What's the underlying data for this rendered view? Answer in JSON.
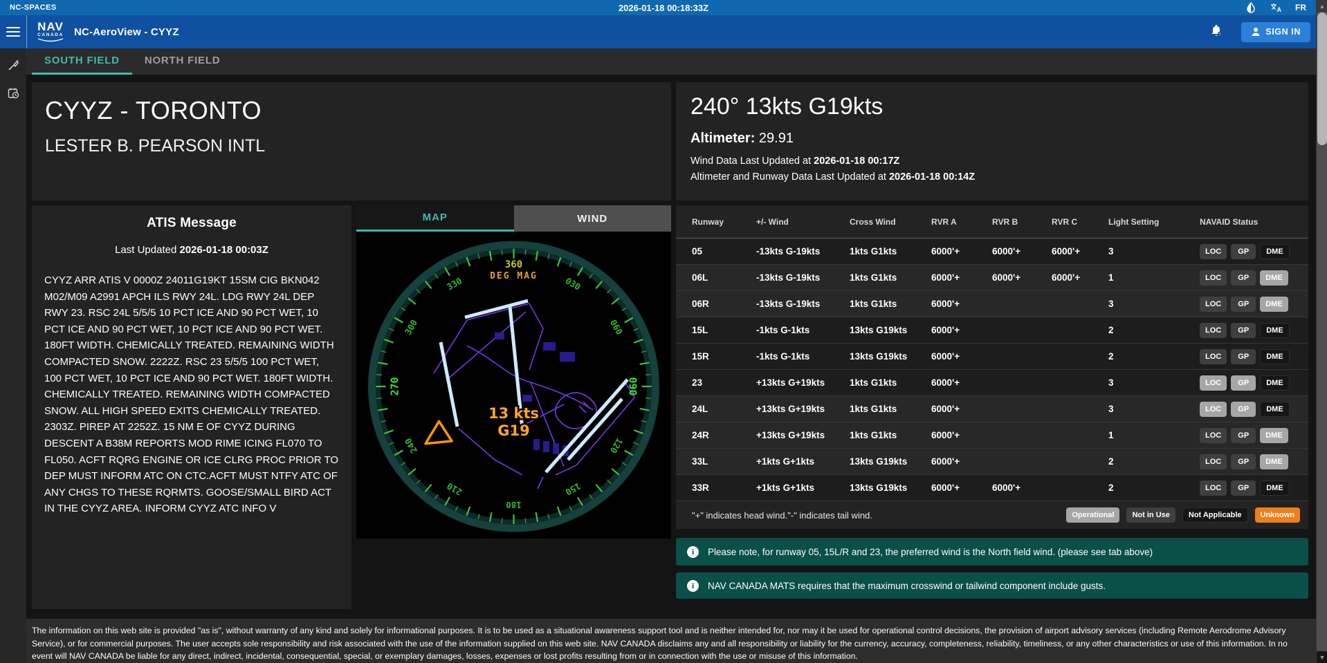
{
  "status_bar": {
    "brand": "NC-SPACES",
    "clock": "2026-01-18 00:18:33Z",
    "language": "FR"
  },
  "app_bar": {
    "logo_top": "NAV",
    "logo_bottom": "CANADA",
    "title": "NC-AeroView - CYYZ",
    "sign_in_label": "SIGN IN"
  },
  "field_tabs": {
    "south": "SOUTH FIELD",
    "north": "NORTH FIELD"
  },
  "airport_card": {
    "title": "CYYZ - TORONTO",
    "subtitle": "LESTER B. PEARSON INTL"
  },
  "wind_card": {
    "headline": "240° 13kts G19kts",
    "altimeter_label": "Altimeter:",
    "altimeter_value": "29.91",
    "wind_updated_prefix": "Wind Data Last Updated at ",
    "wind_updated_time": "2026-01-18 00:17Z",
    "runway_updated_prefix": "Altimeter and Runway Data Last Updated at ",
    "runway_updated_time": "2026-01-18 00:14Z"
  },
  "atis_card": {
    "title": "ATIS Message",
    "updated_prefix": "Last Updated ",
    "updated_time": "2026-01-18 00:03Z",
    "message": "CYYZ ARR ATIS V 0000Z 24011G19KT 15SM CIG BKN042 M02/M09 A2991 APCH ILS RWY 24L. LDG RWY 24L DEP RWY 23. RSC 24L 5/5/5 10 PCT ICE AND 90 PCT WET, 10 PCT ICE AND 90 PCT WET, 10 PCT ICE AND 90 PCT WET. 180FT WIDTH. CHEMICALLY TREATED. REMAINING WIDTH COMPACTED SNOW. 2222Z. RSC 23 5/5/5 100 PCT WET, 100 PCT WET, 10 PCT ICE AND 90 PCT WET. 180FT WIDTH. CHEMICALLY TREATED. REMAINING WIDTH COMPACTED SNOW. ALL HIGH SPEED EXITS CHEMICALLY TREATED. 2303Z. PIREP AT 2252Z. 15 NM E OF CYYZ DURING DESCENT A B38M REPORTS MOD RIME ICING FL070 TO FL050. ACFT RQRG ENGINE OR ICE CLRG PROC PRIOR TO DEP MUST INFORM ATC ON CTC.ACFT MUST NTFY ATC OF ANY CHGS TO THESE RQRMTS. GOOSE/SMALL BIRD ACT IN THE CYYZ AREA. INFORM CYYZ ATC INFO V"
  },
  "map_card": {
    "tab_map": "MAP",
    "tab_wind": "WIND",
    "center_wind_line1": "13 kts",
    "center_wind_line2": "G19",
    "compass": {
      "north_label": "360",
      "deg_mag": "DEG MAG",
      "labels": [
        {
          "angle": 30,
          "text": "030",
          "em": false
        },
        {
          "angle": 60,
          "text": "060",
          "em": false
        },
        {
          "angle": 90,
          "text": "090",
          "em": true
        },
        {
          "angle": 120,
          "text": "120",
          "em": false
        },
        {
          "angle": 150,
          "text": "150",
          "em": false
        },
        {
          "angle": 180,
          "text": "180",
          "em": false
        },
        {
          "angle": 210,
          "text": "210",
          "em": false
        },
        {
          "angle": 240,
          "text": "240",
          "em": false
        },
        {
          "angle": 270,
          "text": "270",
          "em": true
        },
        {
          "angle": 300,
          "text": "300",
          "em": false
        },
        {
          "angle": 330,
          "text": "330",
          "em": false
        }
      ]
    }
  },
  "runway_table": {
    "columns": [
      "Runway",
      "+/- Wind",
      "Cross Wind",
      "RVR A",
      "RVR B",
      "RVR C",
      "Light Setting",
      "NAVAID Status"
    ],
    "rows": [
      {
        "runway": "05",
        "wind": "-13kts G-19kts",
        "cross_wind": "1kts G1kts",
        "rvr_a": "6000'+",
        "rvr_b": "6000'+",
        "rvr_c": "6000'+",
        "light_setting": "3",
        "shaded": true,
        "navaids": [
          {
            "label": "LOC",
            "status": "not_in_use"
          },
          {
            "label": "GP",
            "status": "not_in_use"
          },
          {
            "label": "DME",
            "status": "not_applicable"
          }
        ]
      },
      {
        "runway": "06L",
        "wind": "-13kts G-19kts",
        "cross_wind": "1kts G1kts",
        "rvr_a": "6000'+",
        "rvr_b": "6000'+",
        "rvr_c": "6000'+",
        "light_setting": "1",
        "shaded": false,
        "navaids": [
          {
            "label": "LOC",
            "status": "not_in_use"
          },
          {
            "label": "GP",
            "status": "not_in_use"
          },
          {
            "label": "DME",
            "status": "operational"
          }
        ]
      },
      {
        "runway": "06R",
        "wind": "-13kts G-19kts",
        "cross_wind": "1kts G1kts",
        "rvr_a": "6000'+",
        "rvr_b": "",
        "rvr_c": "",
        "light_setting": "3",
        "shaded": false,
        "navaids": [
          {
            "label": "LOC",
            "status": "not_in_use"
          },
          {
            "label": "GP",
            "status": "not_in_use"
          },
          {
            "label": "DME",
            "status": "operational"
          }
        ]
      },
      {
        "runway": "15L",
        "wind": "-1kts G-1kts",
        "cross_wind": "13kts G19kts",
        "rvr_a": "6000'+",
        "rvr_b": "",
        "rvr_c": "",
        "light_setting": "2",
        "shaded": true,
        "navaids": [
          {
            "label": "LOC",
            "status": "not_in_use"
          },
          {
            "label": "GP",
            "status": "not_in_use"
          },
          {
            "label": "DME",
            "status": "not_applicable"
          }
        ]
      },
      {
        "runway": "15R",
        "wind": "-1kts G-1kts",
        "cross_wind": "13kts G19kts",
        "rvr_a": "6000'+",
        "rvr_b": "",
        "rvr_c": "",
        "light_setting": "2",
        "shaded": true,
        "navaids": [
          {
            "label": "LOC",
            "status": "not_in_use"
          },
          {
            "label": "GP",
            "status": "not_in_use"
          },
          {
            "label": "DME",
            "status": "not_applicable"
          }
        ]
      },
      {
        "runway": "23",
        "wind": "+13kts G+19kts",
        "cross_wind": "1kts G1kts",
        "rvr_a": "6000'+",
        "rvr_b": "",
        "rvr_c": "",
        "light_setting": "3",
        "shaded": true,
        "navaids": [
          {
            "label": "LOC",
            "status": "operational"
          },
          {
            "label": "GP",
            "status": "operational"
          },
          {
            "label": "DME",
            "status": "not_applicable"
          }
        ]
      },
      {
        "runway": "24L",
        "wind": "+13kts G+19kts",
        "cross_wind": "1kts G1kts",
        "rvr_a": "6000'+",
        "rvr_b": "",
        "rvr_c": "",
        "light_setting": "3",
        "shaded": false,
        "navaids": [
          {
            "label": "LOC",
            "status": "operational"
          },
          {
            "label": "GP",
            "status": "operational"
          },
          {
            "label": "DME",
            "status": "not_applicable"
          }
        ]
      },
      {
        "runway": "24R",
        "wind": "+13kts G+19kts",
        "cross_wind": "1kts G1kts",
        "rvr_a": "6000'+",
        "rvr_b": "",
        "rvr_c": "",
        "light_setting": "1",
        "shaded": false,
        "navaids": [
          {
            "label": "LOC",
            "status": "not_in_use"
          },
          {
            "label": "GP",
            "status": "not_in_use"
          },
          {
            "label": "DME",
            "status": "operational"
          }
        ]
      },
      {
        "runway": "33L",
        "wind": "+1kts G+1kts",
        "cross_wind": "13kts G19kts",
        "rvr_a": "6000'+",
        "rvr_b": "",
        "rvr_c": "",
        "light_setting": "2",
        "shaded": false,
        "navaids": [
          {
            "label": "LOC",
            "status": "not_in_use"
          },
          {
            "label": "GP",
            "status": "not_in_use"
          },
          {
            "label": "DME",
            "status": "operational"
          }
        ]
      },
      {
        "runway": "33R",
        "wind": "+1kts G+1kts",
        "cross_wind": "13kts G19kts",
        "rvr_a": "6000'+",
        "rvr_b": "6000'+",
        "rvr_c": "",
        "light_setting": "2",
        "shaded": true,
        "navaids": [
          {
            "label": "LOC",
            "status": "not_in_use"
          },
          {
            "label": "GP",
            "status": "not_in_use"
          },
          {
            "label": "DME",
            "status": "not_applicable"
          }
        ]
      }
    ],
    "legend_note": "\"+\" indicates head wind.\"-\" indicates tail wind.",
    "status_legend": [
      {
        "label": "Operational",
        "status": "operational"
      },
      {
        "label": "Not in Use",
        "status": "not_in_use"
      },
      {
        "label": "Not Applicable",
        "status": "not_applicable"
      },
      {
        "label": "Unknown",
        "status": "unknown"
      }
    ]
  },
  "notes": [
    {
      "text": "Please note, for runway 05, 15L/R and 23, the preferred wind is the North field wind. (please see tab above)"
    },
    {
      "text": "NAV CANADA MATS requires that the maximum crosswind or tailwind component include gusts."
    }
  ],
  "footer": {
    "disclaimer": "The information on this web site is provided \"as is\", without warranty of any kind and solely for informational purposes. It is to be used as a situational awareness support tool and is neither intended for, nor may it be used for operational control decisions, the provision of airport advisory services (including Remote Aerodrome Advisory Service), or for commercial purposes. The user accepts sole responsibility and risk associated with the use of the information supplied on this web site. NAV CANADA disclaims any and all responsibility or liability for the currency, accuracy, completeness, reliability, timeliness, or any other characteristics or use of this information. In no event will NAV CANADA be liable for any direct, indirect, incidental, consequential, special, or exemplary damages, losses, expenses or lost profits resulting from or in connection with the use or misuse of this information."
  },
  "colors": {
    "accent_teal": "#3fbbaa",
    "topbar_blue": "#1068b0",
    "appbar_blue": "#0f51a0",
    "signin_blue": "#2c80d8",
    "note_teal": "#0b4f49",
    "status_unknown_orange": "#ef7f1a",
    "compass_green": "#3ec43e",
    "wind_orange": "#ffa726",
    "runway_cyan": "#cfe9ff",
    "airport_purple": "#7a3df0"
  }
}
